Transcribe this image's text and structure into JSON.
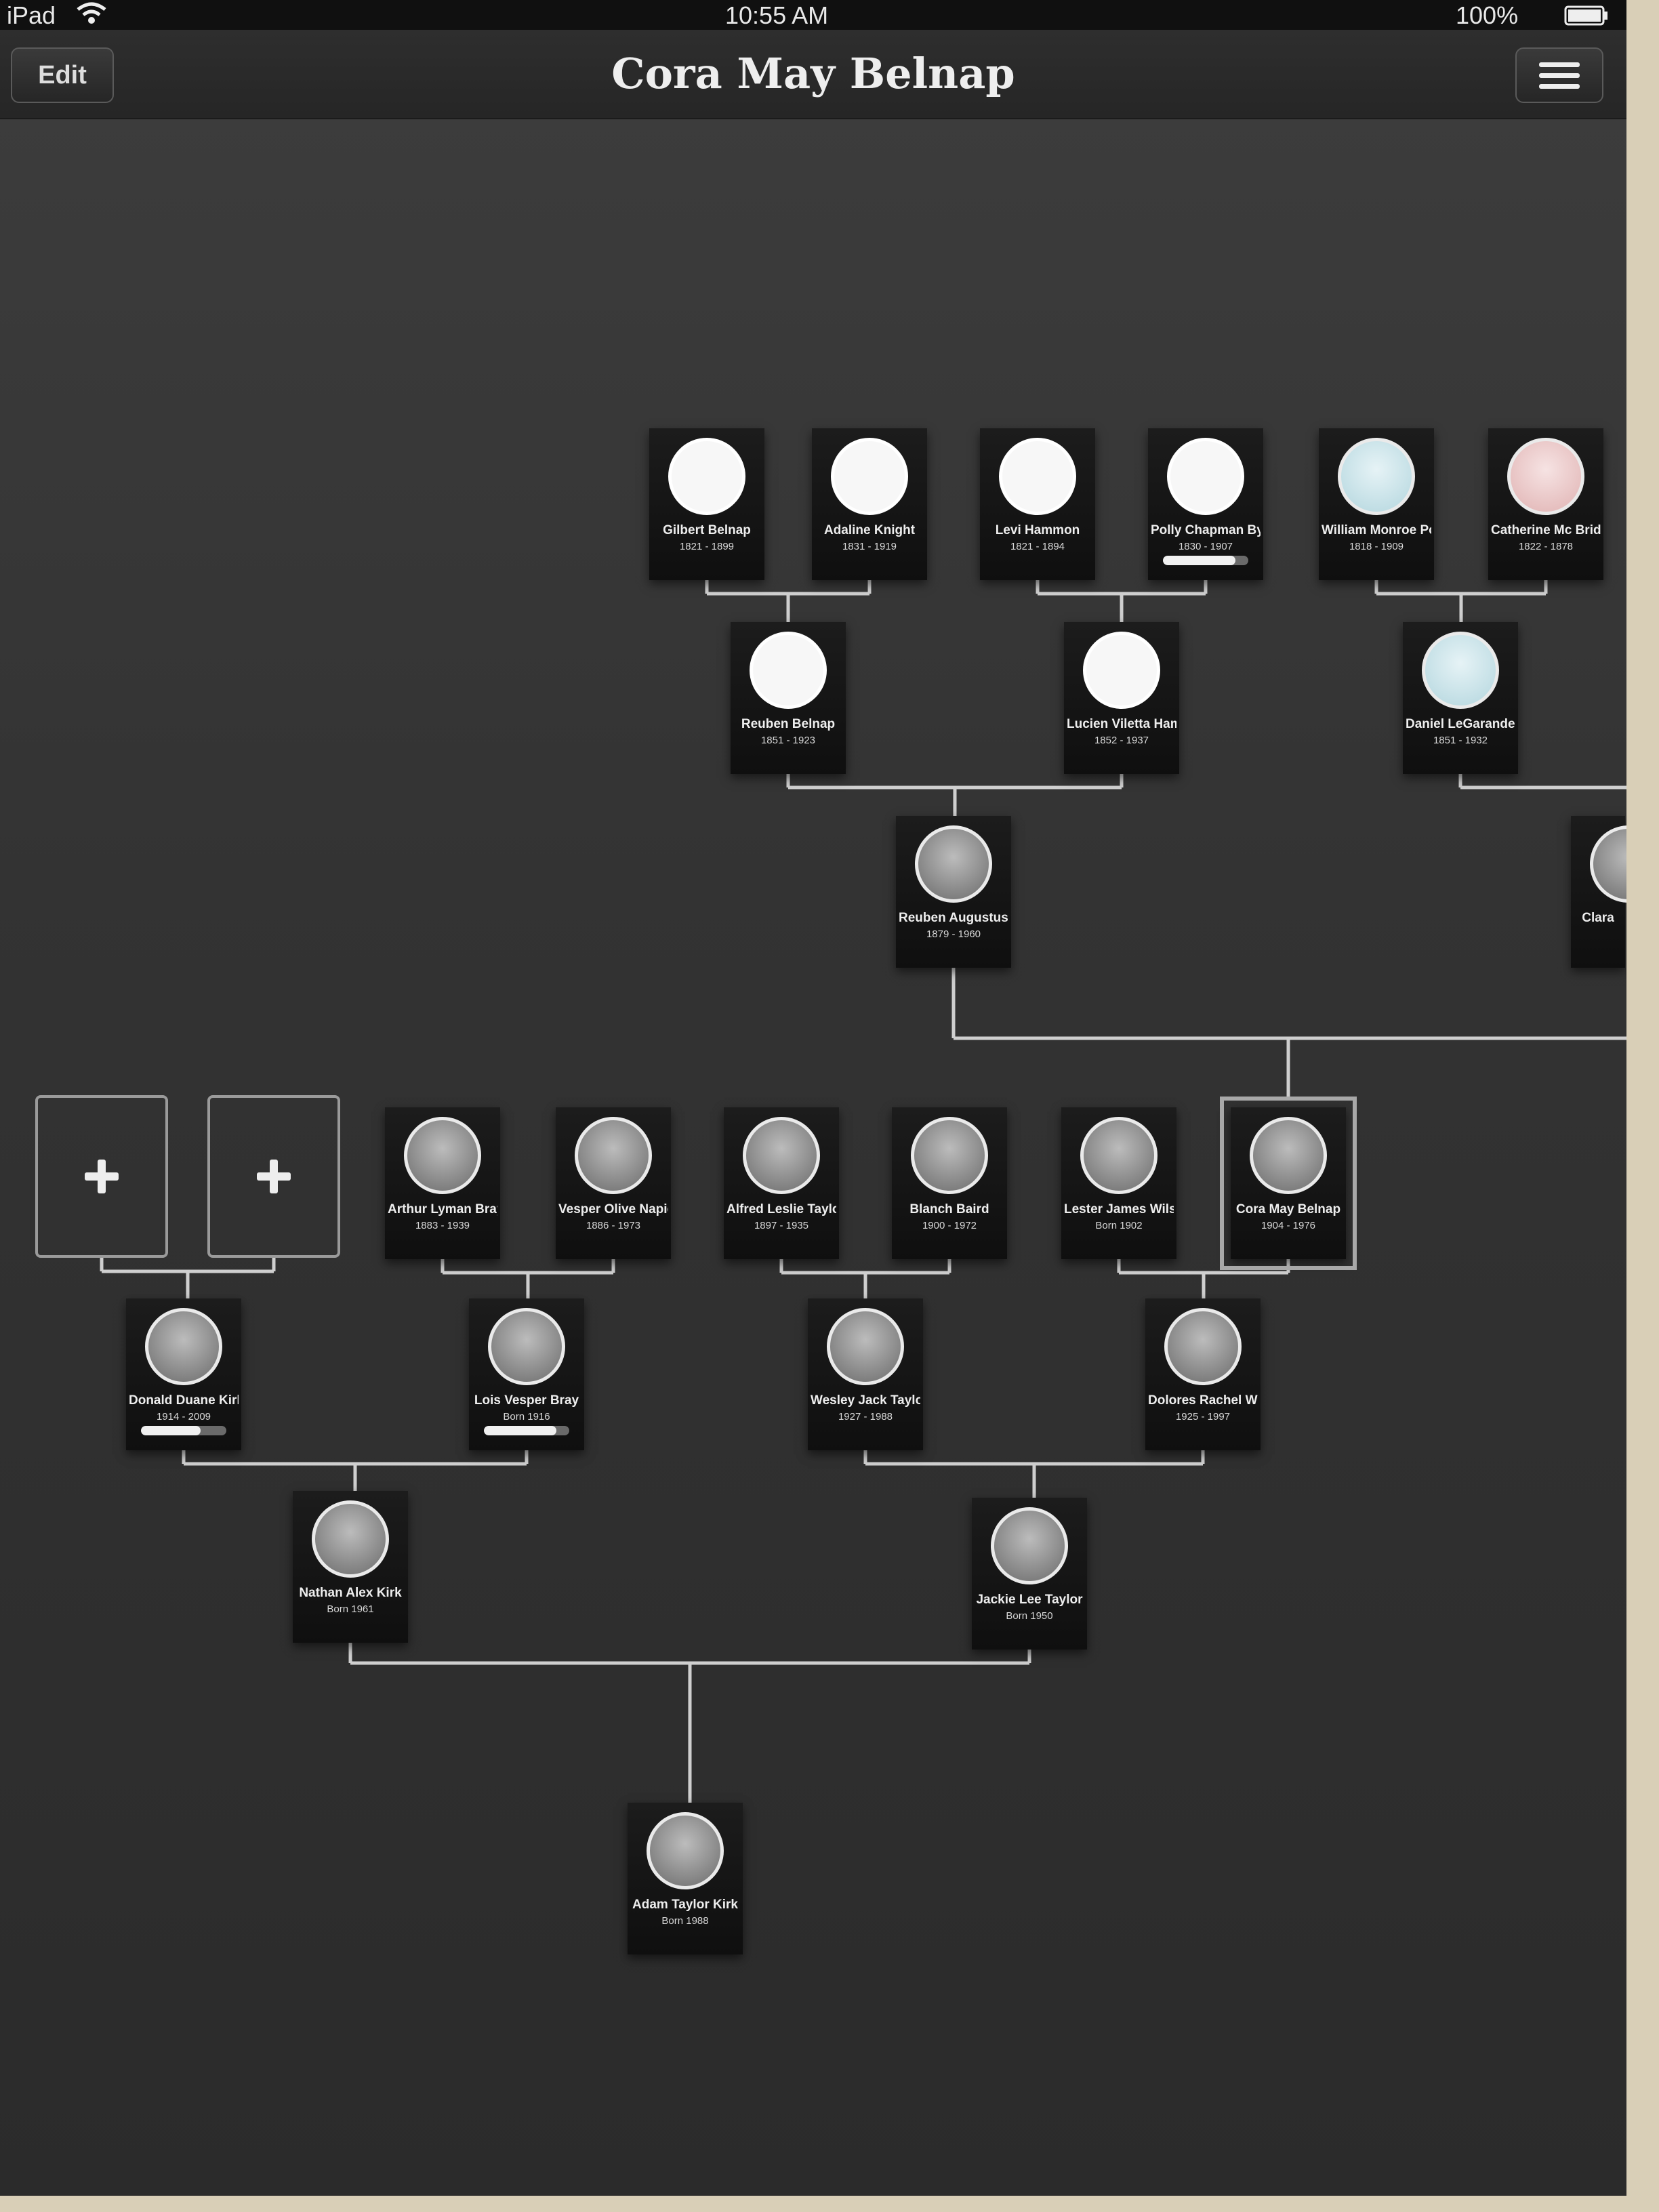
{
  "status_bar": {
    "device": "iPad",
    "time": "10:55 AM",
    "battery": "100%"
  },
  "nav": {
    "title": "Cora May Belnap",
    "edit_label": "Edit",
    "menu_icon": "menu-icon"
  },
  "people": {
    "gilbert": {
      "name": "Gilbert Belnap",
      "dates": "1821 - 1899",
      "photo": "blank"
    },
    "adaline": {
      "name": "Adaline Knight",
      "dates": "1831 - 1919",
      "photo": "blank"
    },
    "levi": {
      "name": "Levi Hammon",
      "dates": "1821 - 1894",
      "photo": "blank"
    },
    "polly": {
      "name": "Polly Chapman Bybee",
      "dates": "1830 - 1907",
      "photo": "blank",
      "progress": 0.85
    },
    "william": {
      "name": "William Monroe Pope",
      "dates": "1818 - 1909",
      "photo": "blue"
    },
    "catherine": {
      "name": "Catherine Mc Bride",
      "dates": "1822 - 1878",
      "photo": "pink"
    },
    "reuben": {
      "name": "Reuben Belnap",
      "dates": "1851 - 1923",
      "photo": "blank"
    },
    "lucien": {
      "name": "Lucien Viletta Hammon",
      "dates": "1852 - 1937",
      "photo": "blank"
    },
    "daniel": {
      "name": "Daniel LeGarande Pope",
      "dates": "1851 - 1932",
      "photo": "blue"
    },
    "reubena": {
      "name": "Reuben Augustus Belnap",
      "dates": "1879 - 1960",
      "photo": "photo"
    },
    "clara": {
      "name": "Clara",
      "dates": "",
      "photo": "photo"
    },
    "arthur": {
      "name": "Arthur Lyman Bray",
      "dates": "1883 - 1939",
      "photo": "photo"
    },
    "vesper": {
      "name": "Vesper Olive Napier",
      "dates": "1886 - 1973",
      "photo": "photo"
    },
    "alfred": {
      "name": "Alfred Leslie Taylor",
      "dates": "1897 - 1935",
      "photo": "photo"
    },
    "blanch": {
      "name": "Blanch Baird",
      "dates": "1900 - 1972",
      "photo": "photo"
    },
    "lester": {
      "name": "Lester James Wilson",
      "dates": "Born 1902",
      "photo": "photo"
    },
    "cora": {
      "name": "Cora May Belnap",
      "dates": "1904 - 1976",
      "photo": "photo",
      "selected": true
    },
    "donald": {
      "name": "Donald Duane Kirk",
      "dates": "1914 - 2009",
      "photo": "photo",
      "progress": 0.7
    },
    "lois": {
      "name": "Lois Vesper Bray",
      "dates": "Born 1916",
      "photo": "photo",
      "progress": 0.85
    },
    "wesley": {
      "name": "Wesley Jack Taylor",
      "dates": "1927 - 1988",
      "photo": "photo"
    },
    "dolores": {
      "name": "Dolores Rachel Wilson",
      "dates": "1925 - 1997",
      "photo": "photo"
    },
    "nathan": {
      "name": "Nathan Alex Kirk",
      "dates": "Born 1961",
      "photo": "photo"
    },
    "jackie": {
      "name": "Jackie Lee Taylor",
      "dates": "Born 1950",
      "photo": "photo"
    },
    "adam": {
      "name": "Adam Taylor Kirk",
      "dates": "Born 1988",
      "photo": "photo"
    }
  },
  "add_slots": [
    {
      "label": "+"
    },
    {
      "label": "+"
    }
  ]
}
